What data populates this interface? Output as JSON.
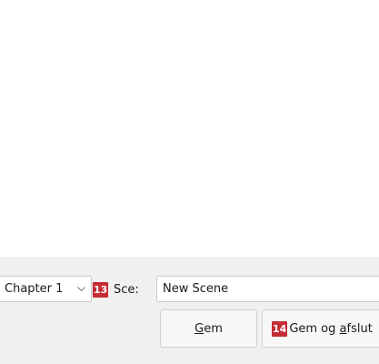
{
  "bottom_panel": {
    "chapter_select": {
      "value": "Chapter 1"
    },
    "scene_label": "Sce:",
    "scene_input": {
      "value": "New Scene"
    },
    "badges": {
      "scene": "13",
      "save_quit": "14"
    },
    "save_button": {
      "mnemonic": "G",
      "rest": "em"
    },
    "save_quit_button": {
      "prefix": "Gem og ",
      "mnemonic": "a",
      "rest": "fslut"
    }
  },
  "colors": {
    "badge": "#c42b34",
    "panel_background": "#f0f0f0",
    "content_background": "#ffffff"
  },
  "icons": {
    "dropdown": "chevron-down-icon"
  }
}
